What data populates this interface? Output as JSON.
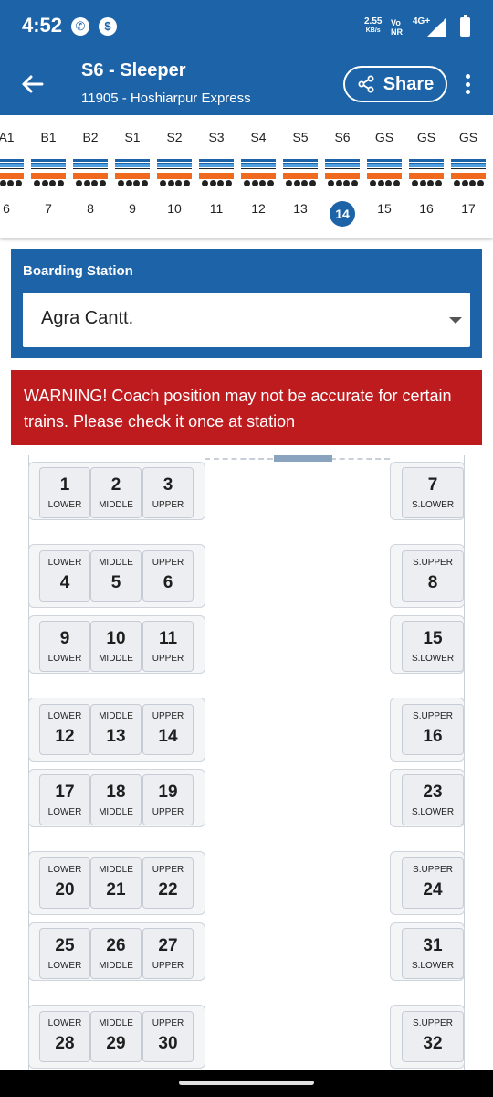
{
  "status_bar": {
    "time": "4:52",
    "net_speed_value": "2.55",
    "net_speed_unit": "KB/s",
    "network_vo": "Vo",
    "network_nr": "NR",
    "network_type": "4G+"
  },
  "app_bar": {
    "title": "S6 - Sleeper",
    "subtitle": "11905 - Hoshiarpur Express",
    "share_label": "Share"
  },
  "coaches": {
    "labels": [
      "A1",
      "B1",
      "B2",
      "S1",
      "S2",
      "S3",
      "S4",
      "S5",
      "S6",
      "GS",
      "GS",
      "GS"
    ],
    "numbers": [
      "6",
      "7",
      "8",
      "9",
      "10",
      "11",
      "12",
      "13",
      "14",
      "15",
      "16",
      "17"
    ],
    "selected_number": "14",
    "coach_colors": {
      "roof": "#1d63a8",
      "body": "#ef6a1f"
    }
  },
  "boarding": {
    "label": "Boarding Station",
    "selected": "Agra Cantt."
  },
  "warning": {
    "text": "WARNING! Coach position may not be accurate for certain trains. Please check it once at station"
  },
  "colors": {
    "primary": "#1d63a8",
    "warning": "#be1b1e"
  },
  "seats": {
    "b1_1_num": "1",
    "b1_1_type": "LOWER",
    "b1_2_num": "2",
    "b1_2_type": "MIDDLE",
    "b1_3_num": "3",
    "b1_3_type": "UPPER",
    "b1_s_num": "7",
    "b1_s_type": "S.LOWER",
    "b2_1_num": "4",
    "b2_1_type": "LOWER",
    "b2_2_num": "5",
    "b2_2_type": "MIDDLE",
    "b2_3_num": "6",
    "b2_3_type": "UPPER",
    "b2_s_num": "8",
    "b2_s_type": "S.UPPER",
    "b3_1_num": "9",
    "b3_1_type": "LOWER",
    "b3_2_num": "10",
    "b3_2_type": "MIDDLE",
    "b3_3_num": "11",
    "b3_3_type": "UPPER",
    "b3_s_num": "15",
    "b3_s_type": "S.LOWER",
    "b4_1_num": "12",
    "b4_1_type": "LOWER",
    "b4_2_num": "13",
    "b4_2_type": "MIDDLE",
    "b4_3_num": "14",
    "b4_3_type": "UPPER",
    "b4_s_num": "16",
    "b4_s_type": "S.UPPER",
    "b5_1_num": "17",
    "b5_1_type": "LOWER",
    "b5_2_num": "18",
    "b5_2_type": "MIDDLE",
    "b5_3_num": "19",
    "b5_3_type": "UPPER",
    "b5_s_num": "23",
    "b5_s_type": "S.LOWER",
    "b6_1_num": "20",
    "b6_1_type": "LOWER",
    "b6_2_num": "21",
    "b6_2_type": "MIDDLE",
    "b6_3_num": "22",
    "b6_3_type": "UPPER",
    "b6_s_num": "24",
    "b6_s_type": "S.UPPER",
    "b7_1_num": "25",
    "b7_1_type": "LOWER",
    "b7_2_num": "26",
    "b7_2_type": "MIDDLE",
    "b7_3_num": "27",
    "b7_3_type": "UPPER",
    "b7_s_num": "31",
    "b7_s_type": "S.LOWER",
    "b8_1_num": "28",
    "b8_1_type": "LOWER",
    "b8_2_num": "29",
    "b8_2_type": "MIDDLE",
    "b8_3_num": "30",
    "b8_3_type": "UPPER",
    "b8_s_num": "32",
    "b8_s_type": "S.UPPER"
  }
}
